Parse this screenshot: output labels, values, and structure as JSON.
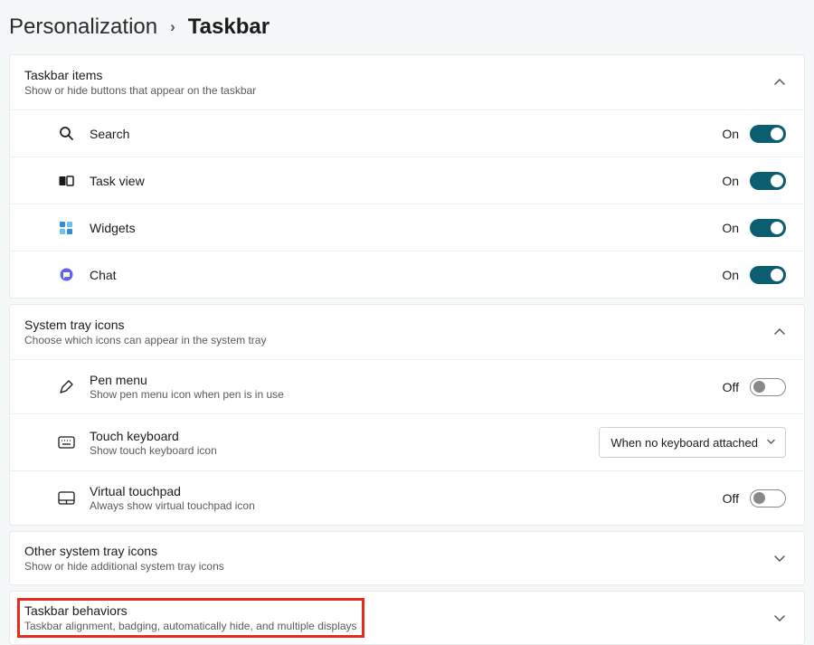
{
  "breadcrumb": {
    "parent": "Personalization",
    "current": "Taskbar"
  },
  "groups": {
    "taskbar_items": {
      "title": "Taskbar items",
      "desc": "Show or hide buttons that appear on the taskbar",
      "rows": {
        "search": {
          "label": "Search",
          "state": "On"
        },
        "taskview": {
          "label": "Task view",
          "state": "On"
        },
        "widgets": {
          "label": "Widgets",
          "state": "On"
        },
        "chat": {
          "label": "Chat",
          "state": "On"
        }
      }
    },
    "tray": {
      "title": "System tray icons",
      "desc": "Choose which icons can appear in the system tray",
      "rows": {
        "pen": {
          "label": "Pen menu",
          "sub": "Show pen menu icon when pen is in use",
          "state": "Off"
        },
        "touchkb": {
          "label": "Touch keyboard",
          "sub": "Show touch keyboard icon",
          "select": "When no keyboard attached"
        },
        "vtouchpad": {
          "label": "Virtual touchpad",
          "sub": "Always show virtual touchpad icon",
          "state": "Off"
        }
      }
    },
    "other_tray": {
      "title": "Other system tray icons",
      "desc": "Show or hide additional system tray icons"
    },
    "behaviors": {
      "title": "Taskbar behaviors",
      "desc": "Taskbar alignment, badging, automatically hide, and multiple displays"
    }
  }
}
